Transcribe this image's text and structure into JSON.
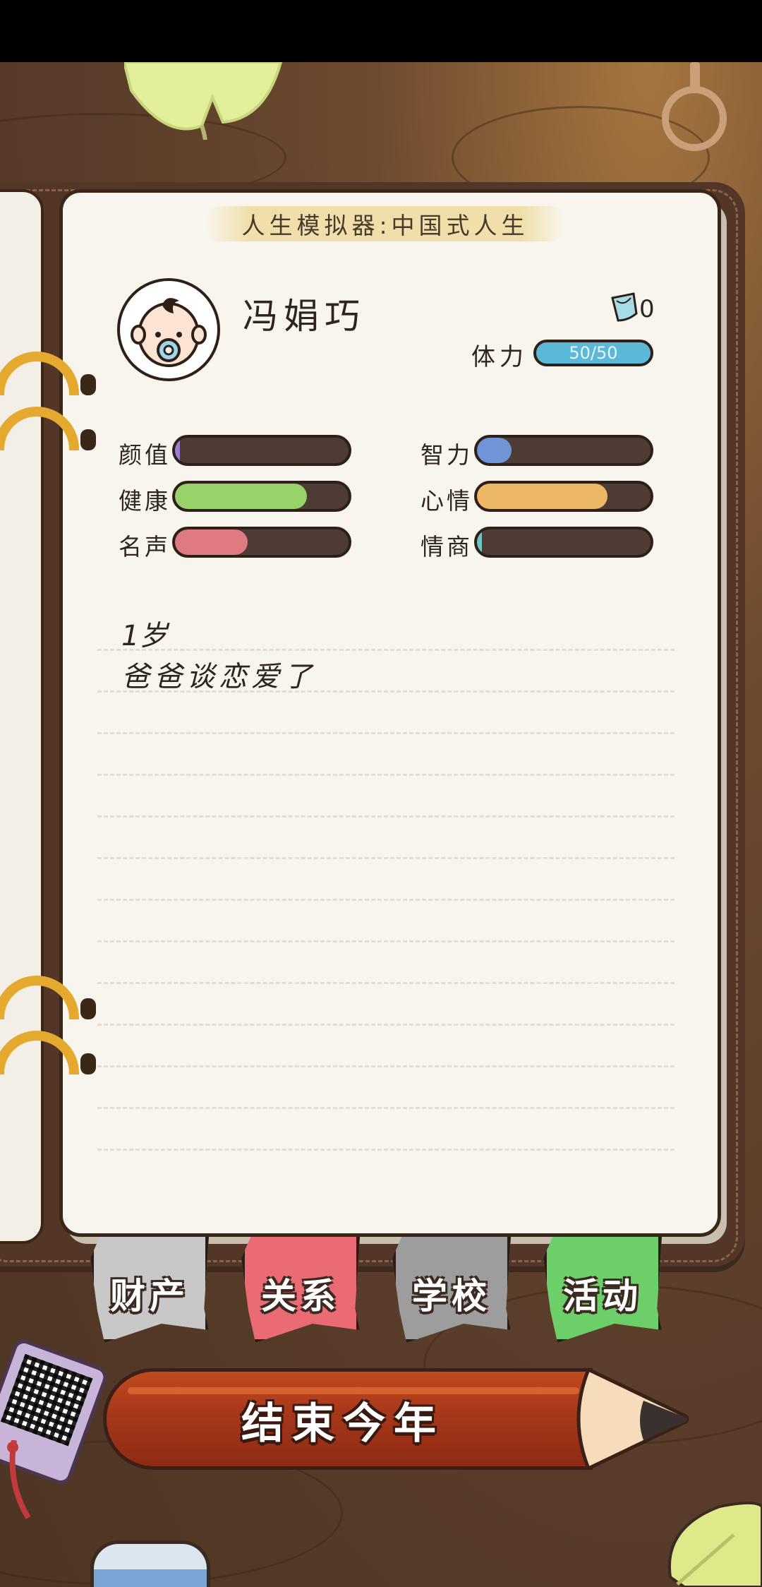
{
  "app": {
    "title": "人生模拟器:中国式人生"
  },
  "player": {
    "name": "冯娟巧",
    "tissues": "0"
  },
  "stamina": {
    "label": "体力",
    "value_text": "50/50",
    "fraction": 1.0
  },
  "stats": [
    {
      "label": "颜值",
      "fraction": 0.02,
      "color": "#9a7fd1"
    },
    {
      "label": "智力",
      "fraction": 0.2,
      "color": "#6f95d8"
    },
    {
      "label": "健康",
      "fraction": 0.76,
      "color": "#97d368"
    },
    {
      "label": "心情",
      "fraction": 0.75,
      "color": "#ecb865"
    },
    {
      "label": "名声",
      "fraction": 0.42,
      "color": "#e07a82"
    },
    {
      "label": "情商",
      "fraction": 0.02,
      "color": "#6fc4c4"
    }
  ],
  "log": {
    "age": "1岁",
    "event": "爸爸谈恋爱了"
  },
  "tabs": [
    {
      "label": "财产",
      "color": "#c8c8c8"
    },
    {
      "label": "关系",
      "color": "#eb6b74"
    },
    {
      "label": "学校",
      "color": "#9d9d9d"
    },
    {
      "label": "活动",
      "color": "#6ccf6a"
    }
  ],
  "end_year_button": {
    "label": "结束今年"
  }
}
